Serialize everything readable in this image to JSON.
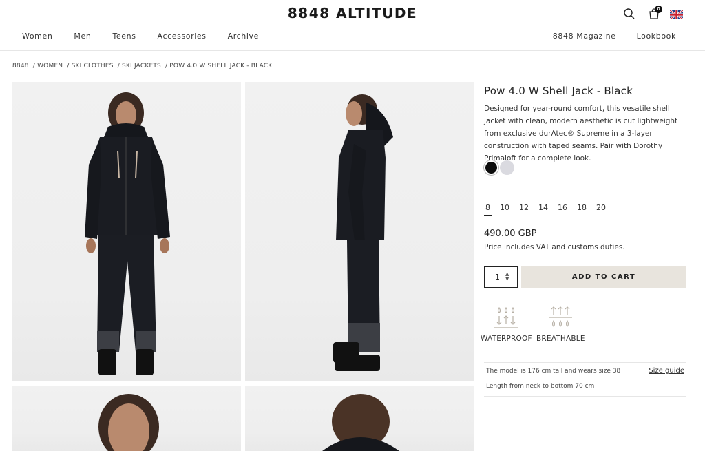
{
  "header": {
    "logo": "8848 ALTITUDE",
    "nav_left": [
      "Women",
      "Men",
      "Teens",
      "Accessories",
      "Archive"
    ],
    "nav_right": [
      "8848 Magazine",
      "Lookbook"
    ],
    "cart_count": "0",
    "icons": [
      "search-icon",
      "cart-icon",
      "uk-flag-icon"
    ]
  },
  "breadcrumb": [
    "8848",
    "/ WOMEN",
    "/ SKI CLOTHES",
    "/ SKI JACKETS",
    "/ POW 4.0 W SHELL JACK - BLACK"
  ],
  "product": {
    "title": "Pow 4.0 W Shell Jack - Black",
    "description": "Designed for year-round comfort, this vesatile shell jacket with clean, modern aesthetic is cut lightweight from exclusive durAtec® Supreme in a 3-layer construction with taped seams. Pair with Dorothy Primaloft for a complete look.",
    "swatches": [
      {
        "name": "black",
        "color": "#0d0d0d",
        "selected": true
      },
      {
        "name": "light-grey",
        "color": "#dadae0",
        "selected": false
      }
    ],
    "sizes": [
      "8",
      "10",
      "12",
      "14",
      "16",
      "18",
      "20"
    ],
    "selected_size": "8",
    "price": "490.00 GBP",
    "vat_note": "Price includes VAT and customs duties.",
    "quantity": "1",
    "add_to_cart": "ADD TO CART",
    "features": [
      {
        "label": "WATERPROOF",
        "icon": "waterproof-icon"
      },
      {
        "label": "BREATHABLE",
        "icon": "breathable-icon"
      }
    ],
    "model_info": "The model is 176 cm tall and wears size 38",
    "size_guide": "Size guide",
    "length_info": "Length from neck to bottom 70 cm"
  },
  "colors": {
    "accent_button": "#e8e4dd",
    "text": "#222222",
    "divider": "#e6e6e6"
  }
}
